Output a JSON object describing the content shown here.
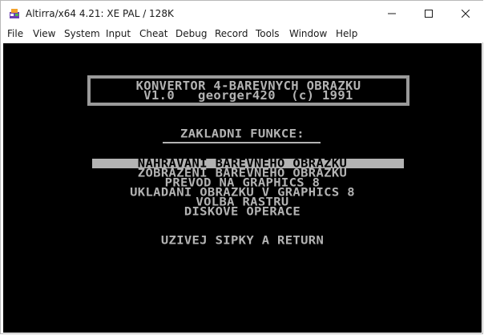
{
  "window": {
    "title": "Altirra/x64 4.21: XE PAL / 128K",
    "app_icon": "altirra-app-icon",
    "controls": [
      "minimize-icon",
      "maximize-icon",
      "close-icon"
    ]
  },
  "menu": [
    "File",
    "View",
    "System",
    "Input",
    "Cheat",
    "Debug",
    "Record",
    "Tools",
    "Window",
    "Help"
  ],
  "emulator_screen": {
    "header_line1": "KONVERTOR 4-BAREVNYCH OBRAZKU",
    "header_line2": "V1.0   georger420  (c) 1991",
    "section_title": "ZAKLADNI FUNKCE:",
    "options": [
      "NAHRAVANI BAREVNEHO OBRAZKU",
      "ZOBRAZENI BAREVNEHO OBRAZKU",
      "PREVOD NA GRAPHICS 8",
      "UKLADANI OBRAZKU V GRAPHICS 8",
      "VOLBA RASTRU",
      "DISKOVE OPERACE"
    ],
    "selected_option": "NAHRAVANI BAREVNEHO OBRAZKU",
    "hint": "UZIVEJ SIPKY A RETURN",
    "colors": {
      "background": "#000000",
      "text": "#b3b3b3",
      "frame": "#9a9a9a"
    }
  }
}
